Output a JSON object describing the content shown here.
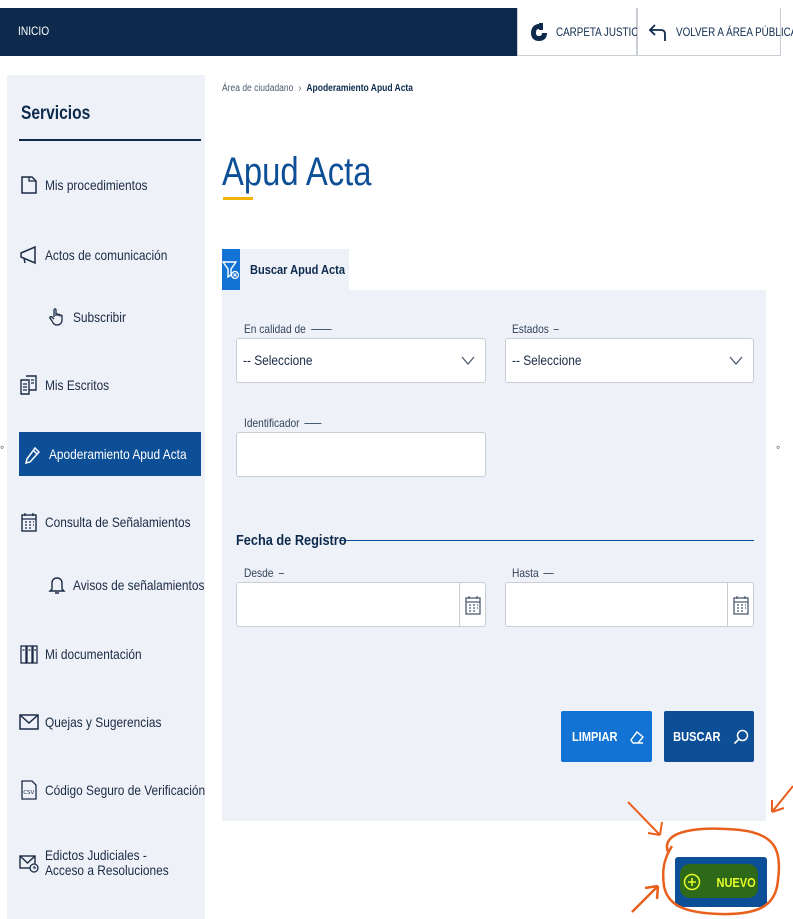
{
  "topbar": {
    "home": "INICIO",
    "carpeta": "CARPETA JUSTICIA",
    "volver": "VOLVER A ÁREA PÚBLICA"
  },
  "sidebar": {
    "title": "Servicios",
    "items": [
      {
        "label": "Mis procedimientos",
        "icon": "document-icon"
      },
      {
        "label": "Actos de comunicación",
        "icon": "megaphone-icon"
      },
      {
        "label": "Subscribir",
        "icon": "hand-pointer-icon"
      },
      {
        "label": "Mis Escritos",
        "icon": "file-list-icon"
      },
      {
        "label": "Apoderamiento Apud Acta",
        "icon": "pen-icon"
      },
      {
        "label": "Consulta de Señalamientos",
        "icon": "calendar-icon"
      },
      {
        "label": "Avisos de señalamientos",
        "icon": "bell-icon"
      },
      {
        "label": "Mi documentación",
        "icon": "binders-icon"
      },
      {
        "label": "Quejas y Sugerencias",
        "icon": "envelope-icon"
      },
      {
        "label": "Código Seguro de Verificación",
        "icon": "csv-icon"
      },
      {
        "label": "Edictos Judiciales - Acceso a Resoluciones",
        "icon": "envelope-clock-icon"
      }
    ]
  },
  "breadcrumb": {
    "root": "Área de ciudadano",
    "separator": "›",
    "current": "Apoderamiento Apud Acta"
  },
  "page": {
    "title": "Apud Acta"
  },
  "tab": {
    "label": "Buscar Apud Acta"
  },
  "form": {
    "calidad_label": "En calidad de",
    "calidad_value": "-- Seleccione",
    "estados_label": "Estados",
    "estados_value": "-- Seleccione",
    "identificador_label": "Identificador",
    "identificador_value": "",
    "fecha_section": "Fecha de Registro",
    "desde_label": "Desde",
    "desde_value": "",
    "hasta_label": "Hasta",
    "hasta_value": ""
  },
  "buttons": {
    "limpiar": "LIMPIAR",
    "buscar": "BUSCAR",
    "nuevo": "NUEVO"
  },
  "colors": {
    "navy": "#0d2a4d",
    "primary": "#0d4f96",
    "accent_blue": "#1273d4",
    "panel_bg": "#eef2f8",
    "title_underline": "#f2b400",
    "annotation": "#e8601c"
  }
}
